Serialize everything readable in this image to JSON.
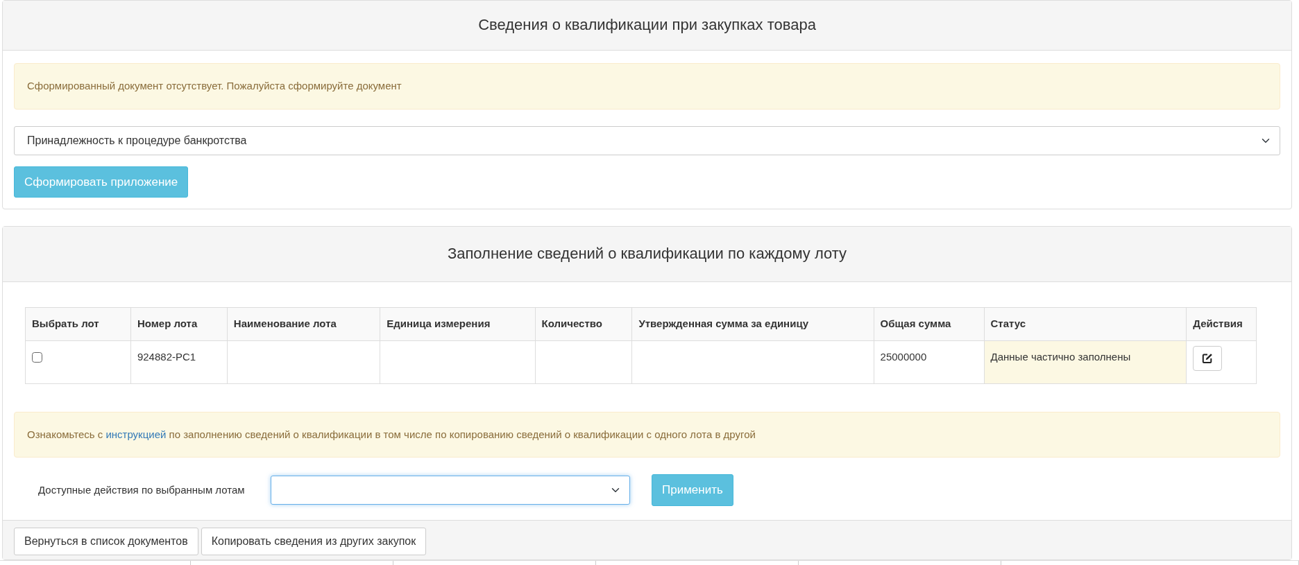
{
  "document_panel": {
    "title": "Сведения о квалификации при закупках товара",
    "alert": "Сформированный документ отсутствует. Пожалуйста сформируйте документ",
    "select": {
      "value": "Принадлежность к процедуре банкротства",
      "focused": false
    },
    "button": "Сформировать приложение"
  },
  "lots_panel": {
    "title": "Заполнение сведений о квалификации по каждому лоту",
    "table": {
      "columns": [
        "Выбрать лот",
        "Номер лота",
        "Наименование лота",
        "Единица измерения",
        "Количество",
        "Утвержденная сумма за единицу",
        "Общая сумма",
        "Статус",
        "Действия"
      ],
      "rows": [
        {
          "checked": false,
          "lot_number": "924882-PC1",
          "total_sum": "25000000",
          "status": "Данные частично заполнены",
          "highlighted": true
        }
      ]
    },
    "alert": {
      "before": "Ознакомьтесь с",
      "link": "инструкцией",
      "after": "по заполнению сведений о квалификации в том числе по копированию сведений о квалификации с одного лота в другой"
    },
    "actions": {
      "label": "Доступные действия по выбранным лотам",
      "focused": true,
      "button": "Применить"
    },
    "footer_buttons": [
      "Вернуться в список документов",
      "Копировать сведения из других закупок"
    ]
  }
}
